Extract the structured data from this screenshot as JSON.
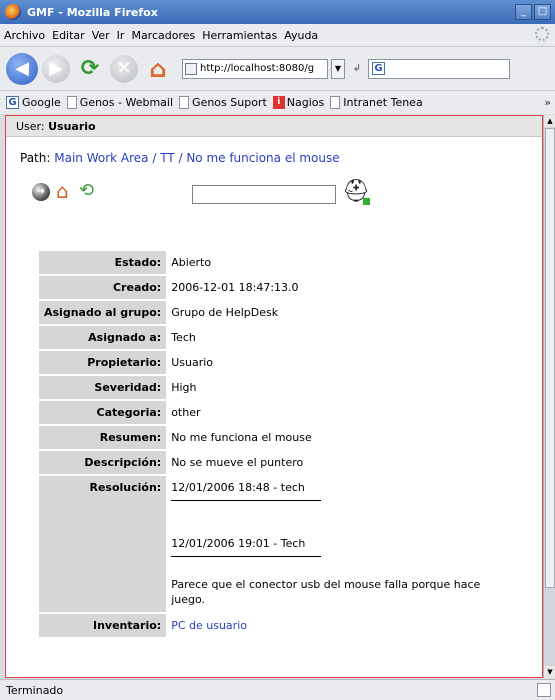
{
  "window": {
    "title": "GMF - Mozilla Firefox"
  },
  "menu": [
    "Archivo",
    "Editar",
    "Ver",
    "Ir",
    "Marcadores",
    "Herramientas",
    "Ayuda"
  ],
  "navigation": {
    "url": "http://localhost:8080/g",
    "search_engine_icon": "google-icon"
  },
  "bookmarks": [
    "Google",
    "Genos - Webmail",
    "Genos Suport",
    "Nagios",
    "Intranet Tenea"
  ],
  "page": {
    "user_label": "User:",
    "user_name": "Usuario",
    "path_label": "Path:",
    "path": {
      "main": "Main Work Area",
      "sep": " / ",
      "tt": "TT",
      "issue": "No me funciona el mouse"
    },
    "search_placeholder": ""
  },
  "ticket": {
    "estado": {
      "label": "Estado:",
      "value": "Abierto"
    },
    "creado": {
      "label": "Creado:",
      "value": "2006-12-01 18:47:13.0"
    },
    "grupo": {
      "label": "Asignado al grupo:",
      "value": "Grupo de HelpDesk"
    },
    "asignado": {
      "label": "Asignado a:",
      "value": "Tech"
    },
    "propietario": {
      "label": "Propietario:",
      "value": "Usuario"
    },
    "severidad": {
      "label": "Severidad:",
      "value": "High"
    },
    "categoria": {
      "label": "Categoria:",
      "value": "other"
    },
    "resumen": {
      "label": "Resumen:",
      "value": "No me funciona el mouse"
    },
    "descripcion": {
      "label": "Descripción:",
      "value": "No se mueve el puntero"
    },
    "resolucion": {
      "label": "Resolución:",
      "entry1": "12/01/2006 18:48 - tech",
      "entry2": "12/01/2006 19:01 - Tech",
      "note": "Parece que el conector usb del mouse falla porque hace juego."
    },
    "inventario": {
      "label": "Inventario:",
      "value": "PC de usuario"
    }
  },
  "status": {
    "text": "Terminado"
  }
}
